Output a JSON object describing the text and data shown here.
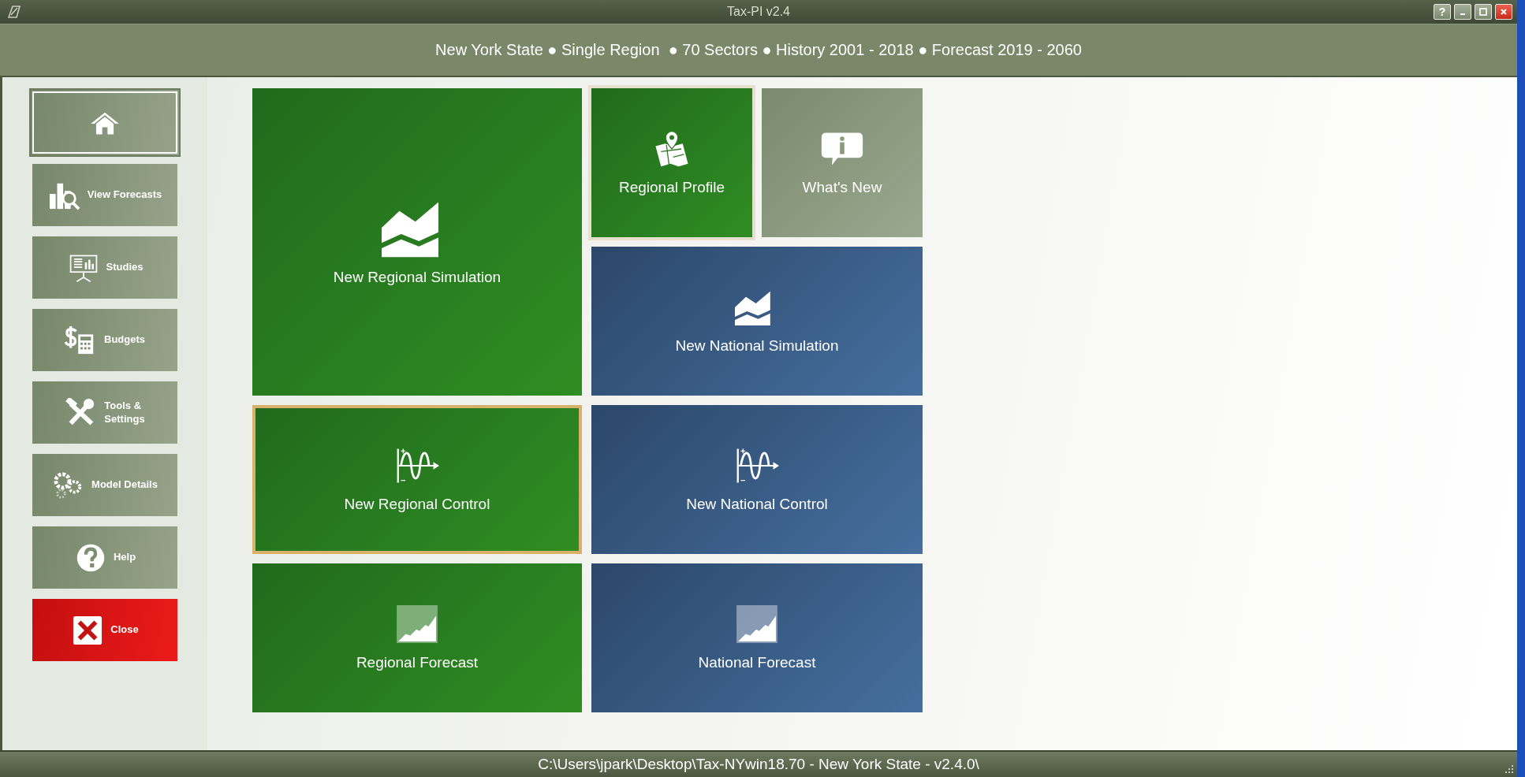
{
  "window": {
    "title": "Tax-PI v2.4",
    "controls": [
      "?"
    ]
  },
  "header": {
    "text": "New York State ● Single Region  ● 70 Sectors ● History 2001 - 2018 ● Forecast 2019 - 2060"
  },
  "sidebar": {
    "items": [
      {
        "kind": "home",
        "selected": true
      },
      {
        "label": "View Forecasts",
        "kind": "nav",
        "selected": false
      },
      {
        "label": "Studies",
        "kind": "nav",
        "selected": false
      },
      {
        "label": "Budgets",
        "kind": "nav",
        "selected": false
      },
      {
        "label": "Tools &\nSettings",
        "kind": "nav",
        "selected": false
      },
      {
        "label": "Model Details",
        "kind": "nav",
        "selected": false
      },
      {
        "label": "Help",
        "kind": "nav",
        "selected": false
      },
      {
        "label": "Close",
        "kind": "danger",
        "selected": false
      }
    ]
  },
  "tiles": [
    {
      "label": "New Regional Simulation",
      "kind": "regional",
      "selected": false,
      "hovered": false
    },
    {
      "label": "Regional Profile",
      "kind": "regional",
      "selected": false,
      "hovered": true
    },
    {
      "label": "What's New",
      "kind": "info",
      "selected": false,
      "hovered": false
    },
    {
      "label": "New National Simulation",
      "kind": "national",
      "selected": false,
      "hovered": false
    },
    {
      "label": "New Regional Control",
      "kind": "regional",
      "selected": true,
      "hovered": false
    },
    {
      "label": "New National Control",
      "kind": "national",
      "selected": false,
      "hovered": false
    },
    {
      "label": "Regional Forecast",
      "kind": "regional",
      "selected": false,
      "hovered": false
    },
    {
      "label": "National Forecast",
      "kind": "national",
      "selected": false,
      "hovered": false
    }
  ],
  "status_bar": {
    "text": "C:\\Users\\jpark\\Desktop\\Tax-NYwin18.70 - New York State - v2.4.0\\"
  }
}
